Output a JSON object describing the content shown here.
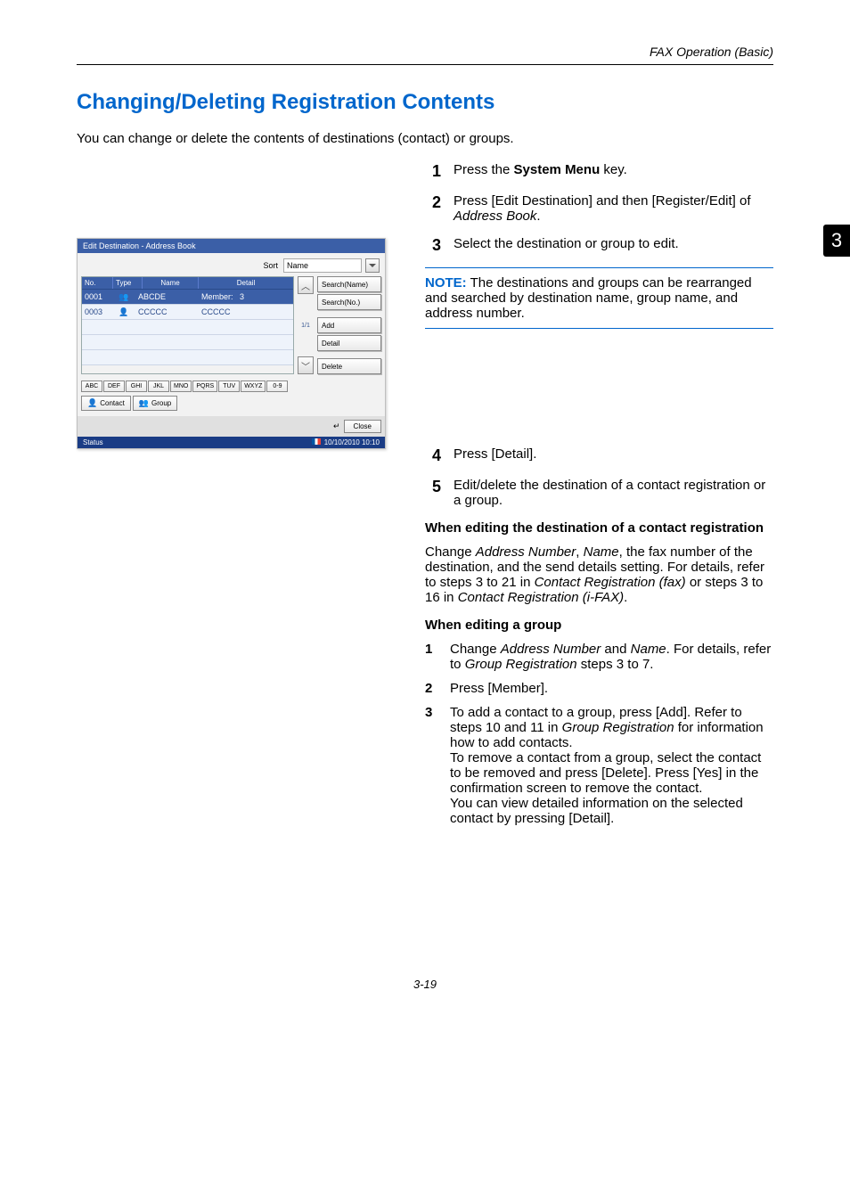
{
  "header": {
    "running": "FAX Operation (Basic)"
  },
  "chapterTab": "3",
  "title": "Changing/Deleting Registration Contents",
  "intro": "You can change or delete the contents of destinations (contact) or groups.",
  "steps": {
    "s1": {
      "num": "1",
      "pressThe": "Press the ",
      "sysMenu": "System Menu",
      "key": " key."
    },
    "s2": {
      "num": "2",
      "a": "Press [Edit Destination] and then [Register/Edit] of ",
      "b": "Address Book",
      "c": "."
    },
    "s3": {
      "num": "3",
      "text": "Select the destination or group to edit."
    },
    "s4": {
      "num": "4",
      "text": "Press [Detail]."
    },
    "s5": {
      "num": "5",
      "text": "Edit/delete the destination of a contact registration or a group."
    }
  },
  "note": {
    "label": "NOTE:",
    "text": " The destinations and groups can be rearranged and searched by destination name, group name, and address number."
  },
  "sub1": {
    "heading": "When editing the destination of a contact registration",
    "p_a": "Change ",
    "p_b": "Address Number",
    "p_c": ", ",
    "p_d": "Name",
    "p_e": ", the fax number of the destination, and the send details setting. For details, refer to steps 3 to 21 in ",
    "p_f": "Contact Registration (fax)",
    "p_g": " or steps 3 to 16 in ",
    "p_h": "Contact Registration (i-FAX)",
    "p_i": "."
  },
  "sub2": {
    "heading": "When editing a group",
    "i1": {
      "num": "1",
      "a": "Change ",
      "b": "Address Number",
      "c": " and ",
      "d": "Name",
      "e": ". For details, refer to ",
      "f": "Group Registration",
      "g": " steps 3 to 7."
    },
    "i2": {
      "num": "2",
      "text": "Press [Member]."
    },
    "i3": {
      "num": "3",
      "a": "To add a contact to a group, press [Add]. Refer to steps 10 and 11 in ",
      "b": "Group Registration",
      "c": " for information how to add contacts.",
      "d": "To remove a contact from a group, select the contact to be removed and press [Delete]. Press [Yes] in the confirmation screen to remove the contact.",
      "e": "You can view detailed information on the selected contact by pressing [Detail]."
    }
  },
  "footer": "3-19",
  "screenshot": {
    "title": "Edit Destination - Address Book",
    "sortLabel": "Sort",
    "nameLabel": "Name",
    "th": {
      "no": "No.",
      "type": "Type",
      "name": "Name",
      "detail": "Detail"
    },
    "rows": [
      {
        "no": "0001",
        "type": "group",
        "name": "ABCDE",
        "detail_a": "Member:",
        "detail_b": "3"
      },
      {
        "no": "0003",
        "type": "contact",
        "name": "CCCCC",
        "detail": "CCCCC"
      }
    ],
    "pageCount": "1/1",
    "sideButtons": {
      "searchName": "Search(Name)",
      "searchNo": "Search(No.)",
      "add": "Add",
      "detail": "Detail",
      "delete": "Delete"
    },
    "alpha": [
      "ABC",
      "DEF",
      "GHI",
      "JKL",
      "MNO",
      "PQRS",
      "TUV",
      "WXYZ",
      "0-9"
    ],
    "tabs": {
      "contact": "Contact",
      "group": "Group"
    },
    "close": "Close",
    "status": "Status",
    "datetime": "10/10/2010   10:10"
  }
}
